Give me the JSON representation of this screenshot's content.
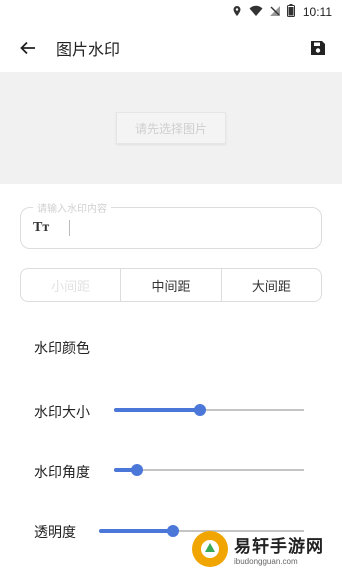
{
  "status_bar": {
    "time": "10:11"
  },
  "app_bar": {
    "title": "图片水印"
  },
  "image_area": {
    "select_button_label": "请先选择图片"
  },
  "text_input": {
    "label": "请输入水印内容",
    "icon_text": "Tт",
    "value": ""
  },
  "spacing": {
    "options": [
      "小间距",
      "中间距",
      "大间距"
    ],
    "selected_index": 0
  },
  "settings": {
    "color_label": "水印颜色",
    "size": {
      "label": "水印大小",
      "value_fraction": 0.45
    },
    "angle": {
      "label": "水印角度",
      "value_fraction": 0.12
    },
    "opacity": {
      "label": "透明度",
      "value_fraction": 0.36
    }
  },
  "watermark": {
    "main": "易轩手游网",
    "sub": "ibudongguan.com"
  },
  "colors": {
    "accent": "#4a77d8",
    "track": "#c4c4c4"
  }
}
